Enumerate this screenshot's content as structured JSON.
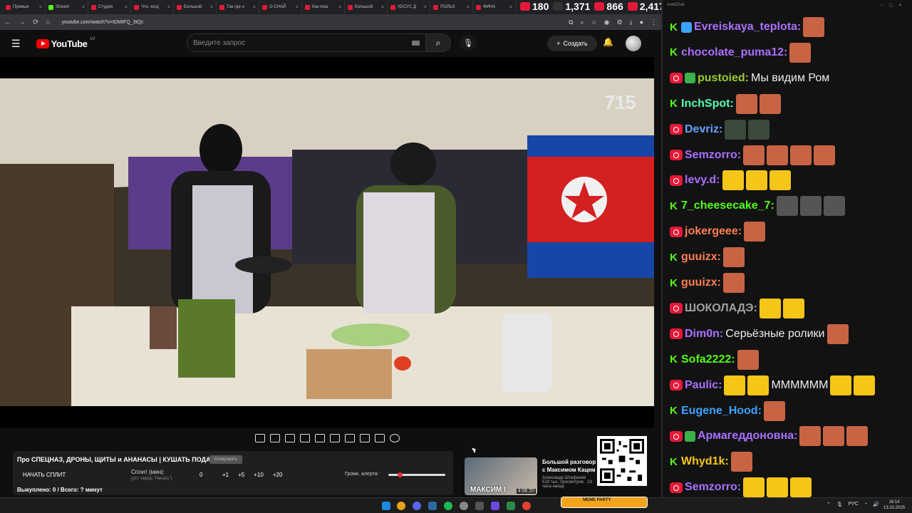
{
  "browser": {
    "tabs": [
      {
        "label": "Прямые",
        "color": "#e51937"
      },
      {
        "label": "Stream",
        "color": "#53fc18"
      },
      {
        "label": "Студия",
        "color": "#e51937"
      },
      {
        "label": "Что, когд",
        "color": "#e51937"
      },
      {
        "label": "Большой",
        "color": "#e51937"
      },
      {
        "label": "Так где н",
        "color": "#e51937"
      },
      {
        "label": "О СНАЙ",
        "color": "#e51937"
      },
      {
        "label": "Как пиш",
        "color": "#e51937"
      },
      {
        "label": "Большой",
        "color": "#e51937"
      },
      {
        "label": "ХЕСУС Д",
        "color": "#e51937"
      },
      {
        "label": "ПОЛЬЗ",
        "color": "#e51937"
      },
      {
        "label": "ФИНА",
        "color": "#e51937"
      }
    ],
    "url": "youtube.com/watch?v=tDMIFQ_3tQc"
  },
  "viewer_stats": {
    "a": "180",
    "b": "1,371",
    "c": "866",
    "d": "2,417"
  },
  "youtube": {
    "logo": "YouTube",
    "region": "LV",
    "search_placeholder": "Введите запрос",
    "create_label": "Создать"
  },
  "video": {
    "watermark": "715"
  },
  "panel": {
    "title": "Про СПЕЦНАЗ, ДРОНЫ, ЩИТЫ и АНАНАСЫ | КУШАТЬ ПОДАНО!",
    "badge": "Копировать",
    "start_split": "НАЧАТЬ СПЛИТ",
    "split_label": "Сплит (мин):",
    "split_hint": "(уст. перед \"Начать\")",
    "split_value": "0",
    "increments": [
      "+1",
      "+5",
      "+10",
      "+20"
    ],
    "alert_volume": "Громк. алерта:",
    "alert_volume_level": 0.2,
    "bought": "Выкуплено: 0 / Всего: ? минут"
  },
  "recommendation": {
    "thumb_caption": "МАКСИМ І",
    "duration": "4:06:20",
    "title": "Большой разговор с Максимом Кацем",
    "channel": "Александр Штефанов",
    "views": "518 тыс. просмотров · 23 часа назад"
  },
  "chat": {
    "header": "AxelChat",
    "messages": [
      {
        "platform": "k",
        "badge2": "#3ba3ff",
        "user": "Evreiskaya_teplota:",
        "color": "#a970ff",
        "text": "",
        "emotes": [
          "#c86444"
        ]
      },
      {
        "platform": "k",
        "badge2": "",
        "user": "chocolate_puma12:",
        "color": "#a970ff",
        "text": "",
        "emotes": [
          "#c86444"
        ]
      },
      {
        "platform": "live",
        "badge2": "#3bb24b",
        "user": "pustoied:",
        "color": "#9acd32",
        "text": "Мы видим Ром",
        "emotes": []
      },
      {
        "platform": "k",
        "badge2": "",
        "user": "InchSpot:",
        "color": "#53fcb4",
        "text": "",
        "emotes": [
          "#c86444",
          "#c86444"
        ]
      },
      {
        "platform": "live",
        "badge2": "",
        "user": "Devriz:",
        "color": "#5fa3ff",
        "text": "",
        "emotes": [
          "#3c4a3c",
          "#3c4a3c"
        ]
      },
      {
        "platform": "live",
        "badge2": "",
        "user": "Semzorro:",
        "color": "#a970ff",
        "text": "",
        "emotes": [
          "#c86444",
          "#c86444",
          "#c86444",
          "#c86444"
        ]
      },
      {
        "platform": "live",
        "badge2": "",
        "user": "levy.d:",
        "color": "#a970ff",
        "text": "",
        "emotes": [
          "#f5c518",
          "#f5c518",
          "#f5c518"
        ]
      },
      {
        "platform": "k",
        "badge2": "",
        "user": "7_cheesecake_7:",
        "color": "#53fc18",
        "text": "",
        "emotes": [
          "#555",
          "#555",
          "#555"
        ]
      },
      {
        "platform": "live",
        "badge2": "",
        "user": "jokergeee:",
        "color": "#ff7f50",
        "text": "",
        "emotes": [
          "#c86444"
        ]
      },
      {
        "platform": "k",
        "badge2": "",
        "user": "guuizx:",
        "color": "#ff7f50",
        "text": "",
        "emotes": [
          "#c86444"
        ]
      },
      {
        "platform": "k",
        "badge2": "",
        "user": "guuizx:",
        "color": "#ff7f50",
        "text": "",
        "emotes": [
          "#c86444"
        ]
      },
      {
        "platform": "live",
        "badge2": "",
        "user": "ШОКОЛАДЭ:",
        "color": "#a0a0a0",
        "text": "",
        "emotes": [
          "#f5c518",
          "#f5c518"
        ]
      },
      {
        "platform": "live",
        "badge2": "",
        "user": "Dim0n:",
        "color": "#a970ff",
        "text": "Серьёзные ролики",
        "emotes": [
          "#c86444"
        ]
      },
      {
        "platform": "k",
        "badge2": "",
        "user": "Sofa2222:",
        "color": "#53fc18",
        "text": "",
        "emotes": [
          "#c86444"
        ]
      },
      {
        "platform": "live",
        "badge2": "",
        "user": "Paulic:",
        "color": "#a970ff",
        "text": "",
        "emotes": [
          "#f5c518",
          "#f5c518"
        ],
        "text2": "ММММММ",
        "emotes2": [
          "#f5c518",
          "#f5c518"
        ]
      },
      {
        "platform": "k",
        "badge2": "",
        "user": "Eugene_Hood:",
        "color": "#3ba3ff",
        "text": "",
        "emotes": [
          "#c86444"
        ]
      },
      {
        "platform": "live",
        "badge2": "#3bb24b",
        "user": "Армагеддоновна:",
        "color": "#a970ff",
        "text": "",
        "emotes": [
          "#c86444",
          "#c86444",
          "#c86444"
        ]
      },
      {
        "platform": "k",
        "badge2": "",
        "user": "Whyd1k:",
        "color": "#f5c518",
        "text": "",
        "emotes": [
          "#c86444"
        ]
      },
      {
        "platform": "live",
        "badge2": "",
        "user": "Semzorro:",
        "color": "#a970ff",
        "text": "",
        "emotes": [
          "#f5c518",
          "#f5c518",
          "#f5c518"
        ]
      }
    ]
  },
  "taskbar": {
    "lang": "РУС",
    "time": "16:14",
    "date": "13.10.2025",
    "kick_bar": "MEME PARTY"
  }
}
